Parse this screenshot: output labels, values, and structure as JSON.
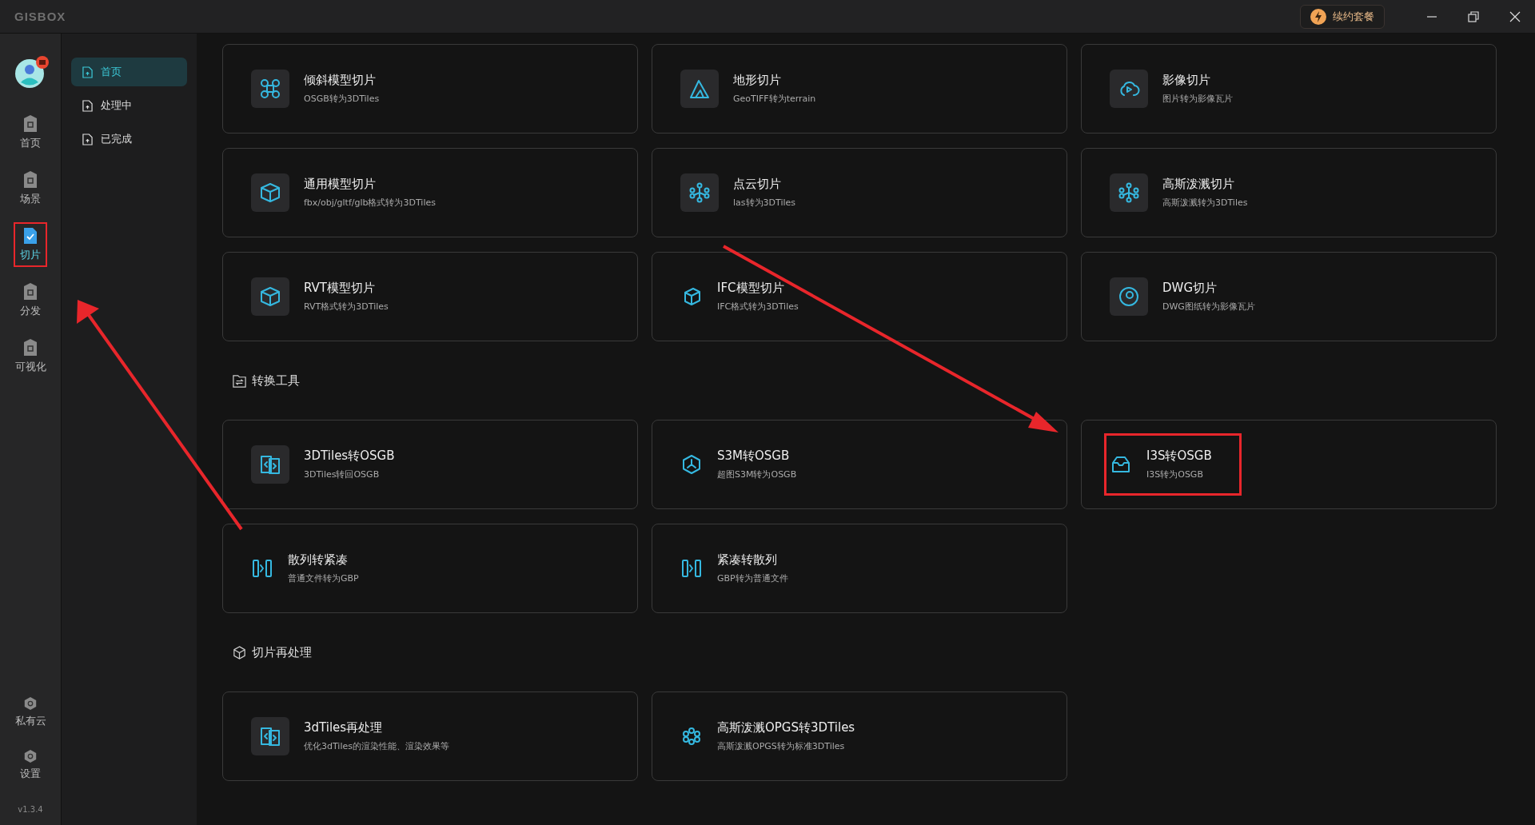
{
  "window": {
    "logo": "GISBOX",
    "renew_button": "续约套餐"
  },
  "rail": {
    "items": [
      {
        "label": "首页",
        "selected": false,
        "highlighted": false
      },
      {
        "label": "场景",
        "selected": false,
        "highlighted": false
      },
      {
        "label": "切片",
        "selected": true,
        "highlighted": true
      },
      {
        "label": "分发",
        "selected": false,
        "highlighted": false
      },
      {
        "label": "可视化",
        "selected": false,
        "highlighted": false
      }
    ],
    "bottom_items": [
      {
        "label": "私有云"
      },
      {
        "label": "设置"
      }
    ],
    "version": "v1.3.4"
  },
  "subnav": [
    {
      "label": "首页",
      "selected": true
    },
    {
      "label": "处理中",
      "selected": false
    },
    {
      "label": "已完成",
      "selected": false
    }
  ],
  "sections": [
    {
      "cards": [
        {
          "title": "倾斜模型切片",
          "subtitle": "OSGB转为3DTiles",
          "icon_tile": true,
          "highlighted": false
        },
        {
          "title": "地形切片",
          "subtitle": "GeoTIFF转为terrain",
          "icon_tile": true,
          "highlighted": false
        },
        {
          "title": "影像切片",
          "subtitle": "图片转为影像瓦片",
          "icon_tile": true,
          "highlighted": false
        },
        {
          "title": "通用模型切片",
          "subtitle": "fbx/obj/gltf/glb格式转为3DTiles",
          "icon_tile": true,
          "highlighted": false
        },
        {
          "title": "点云切片",
          "subtitle": "las转为3DTiles",
          "icon_tile": true,
          "highlighted": false
        },
        {
          "title": "高斯泼溅切片",
          "subtitle": "高斯泼溅转为3DTiles",
          "icon_tile": true,
          "highlighted": false
        },
        {
          "title": "RVT模型切片",
          "subtitle": "RVT格式转为3DTiles",
          "icon_tile": true,
          "highlighted": false
        },
        {
          "title": "IFC模型切片",
          "subtitle": "IFC格式转为3DTiles",
          "icon_tile": false,
          "highlighted": false
        },
        {
          "title": "DWG切片",
          "subtitle": "DWG图纸转为影像瓦片",
          "icon_tile": true,
          "highlighted": false
        }
      ]
    },
    {
      "title": "转换工具",
      "cards": [
        {
          "title": "3DTiles转OSGB",
          "subtitle": "3DTiles转回OSGB",
          "icon_tile": true,
          "highlighted": false
        },
        {
          "title": "S3M转OSGB",
          "subtitle": "超图S3M转为OSGB",
          "icon_tile": false,
          "highlighted": false
        },
        {
          "title": "I3S转OSGB",
          "subtitle": "I3S转为OSGB",
          "icon_tile": false,
          "highlighted": true
        },
        {
          "title": "散列转紧凑",
          "subtitle": "普通文件转为GBP",
          "icon_tile": false,
          "highlighted": false
        },
        {
          "title": "紧凑转散列",
          "subtitle": "GBP转为普通文件",
          "icon_tile": false,
          "highlighted": false
        }
      ]
    },
    {
      "title": "切片再处理",
      "cards": [
        {
          "title": "3dTiles再处理",
          "subtitle": "优化3dTiles的渲染性能、渲染效果等",
          "icon_tile": true,
          "highlighted": false
        },
        {
          "title": "高斯泼溅OPGS转3DTiles",
          "subtitle": "高斯泼溅OPGS转为标准3DTiles",
          "icon_tile": false,
          "highlighted": false
        }
      ]
    }
  ],
  "annotation_arrows": true
}
